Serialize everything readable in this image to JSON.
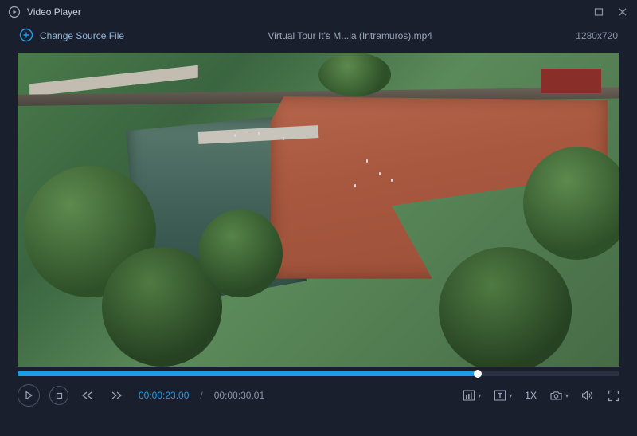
{
  "app": {
    "title": "Video Player"
  },
  "source": {
    "change_label": "Change Source File",
    "filename": "Virtual Tour It's M...la (Intramuros).mp4",
    "resolution": "1280x720"
  },
  "playback": {
    "current_time": "00:00:23.00",
    "total_time": "00:00:30.01",
    "progress_percent": 76.4,
    "speed_label": "1X"
  }
}
